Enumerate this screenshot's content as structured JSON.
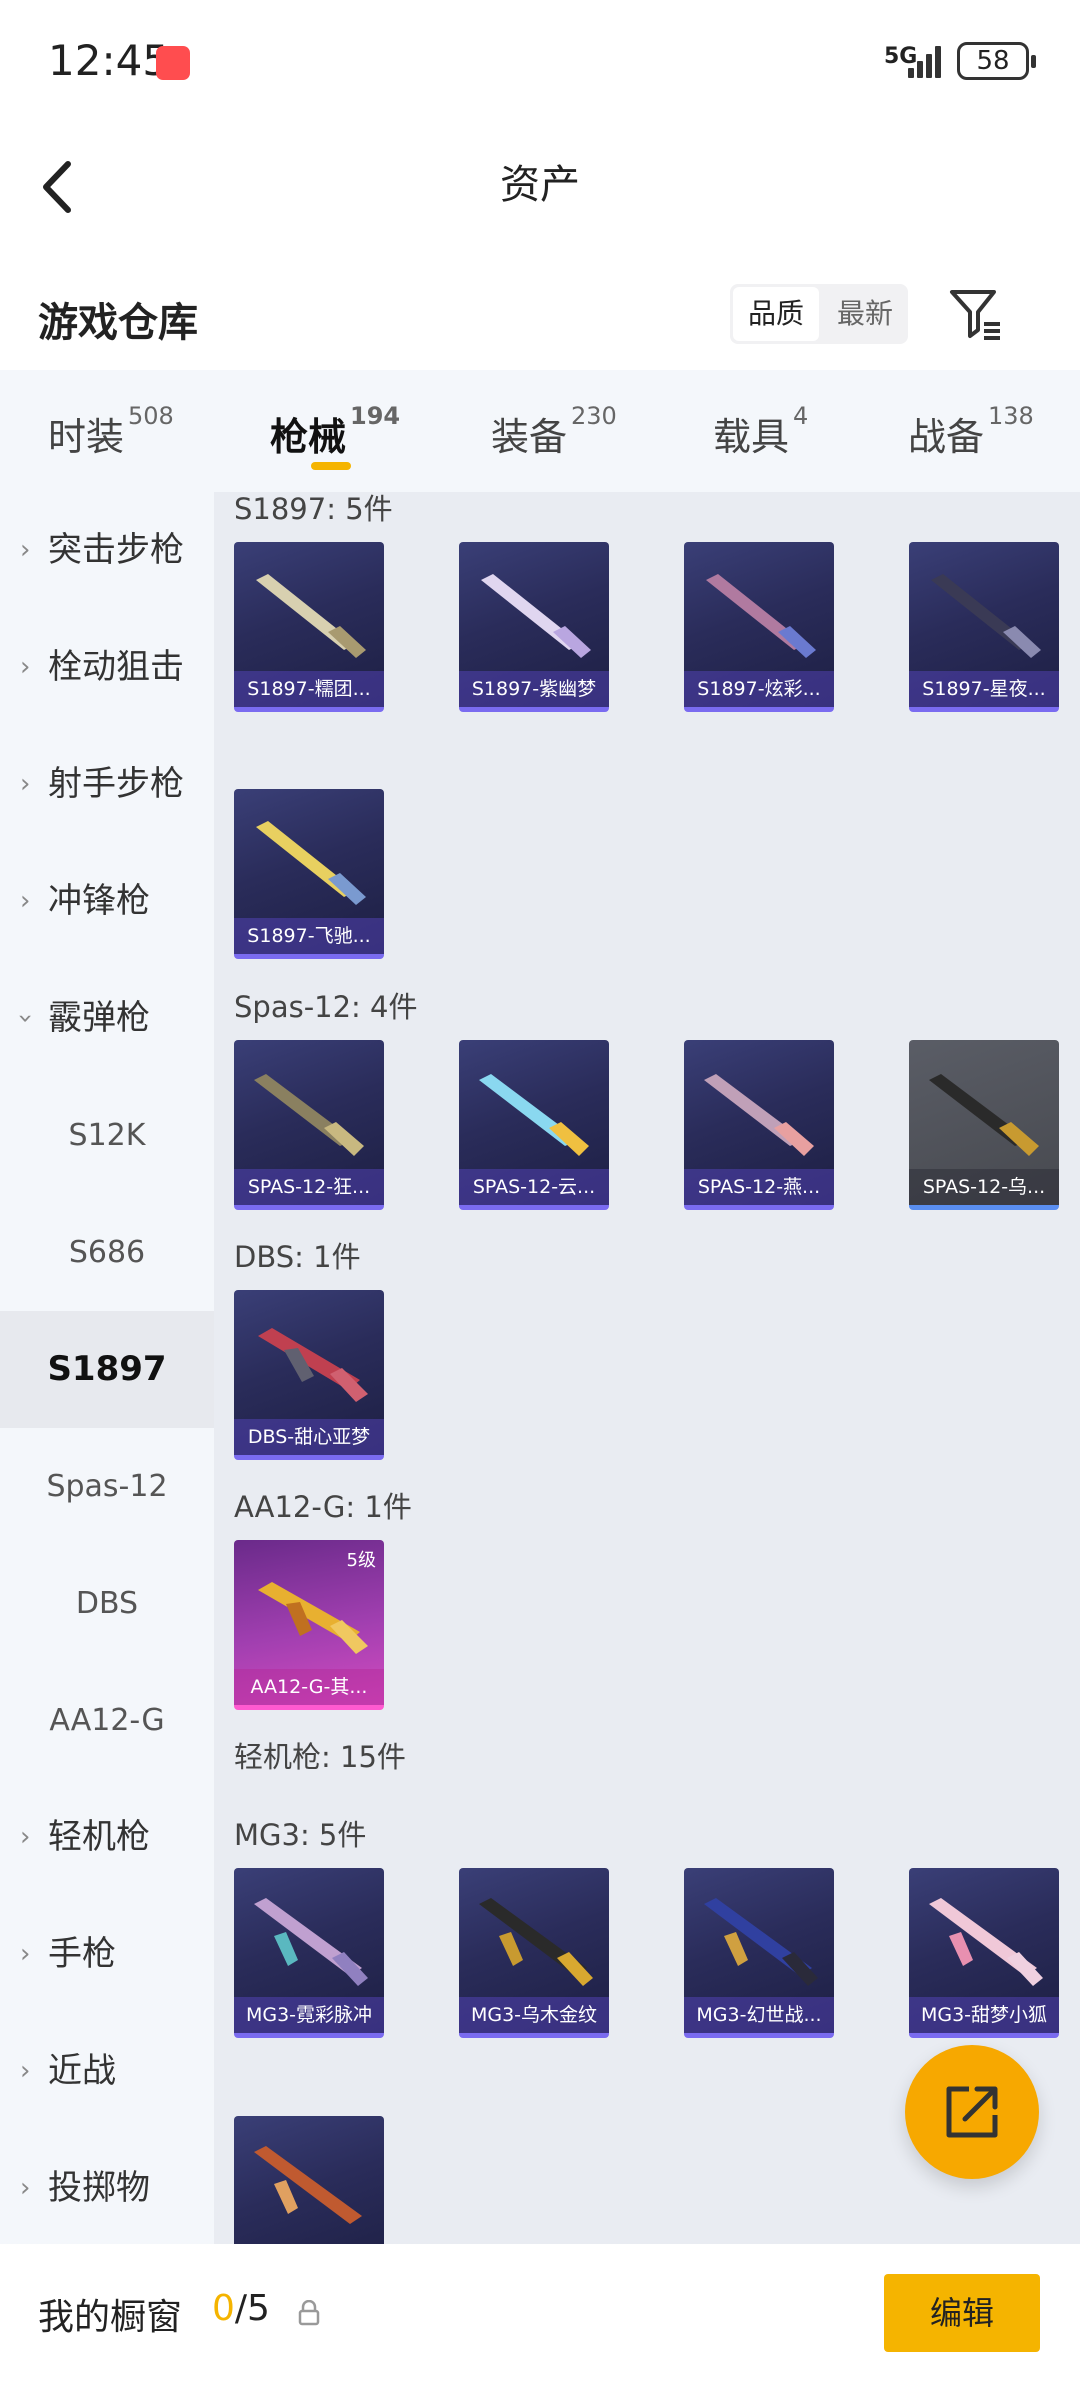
{
  "status_bar": {
    "time": "12:45",
    "network": "5G",
    "battery": "58"
  },
  "header": {
    "title": "资产"
  },
  "warehouse": {
    "title": "游戏仓库",
    "sort_options": [
      "品质",
      "最新"
    ],
    "selected_sort": "品质"
  },
  "tabs": [
    {
      "label": "时装",
      "count": "508"
    },
    {
      "label": "枪械",
      "count": "194"
    },
    {
      "label": "装备",
      "count": "230"
    },
    {
      "label": "载具",
      "count": "4"
    },
    {
      "label": "战备",
      "count": "138"
    }
  ],
  "active_tab": "枪械",
  "sidebar": [
    {
      "label": "突击步枪",
      "type": "category",
      "expanded": false
    },
    {
      "label": "栓动狙击",
      "type": "category",
      "expanded": false
    },
    {
      "label": "射手步枪",
      "type": "category",
      "expanded": false
    },
    {
      "label": "冲锋枪",
      "type": "category",
      "expanded": false
    },
    {
      "label": "霰弹枪",
      "type": "category",
      "expanded": true
    },
    {
      "label": "S12K",
      "type": "sub"
    },
    {
      "label": "S686",
      "type": "sub"
    },
    {
      "label": "S1897",
      "type": "sub",
      "selected": true
    },
    {
      "label": "Spas-12",
      "type": "sub"
    },
    {
      "label": "DBS",
      "type": "sub"
    },
    {
      "label": "AA12-G",
      "type": "sub"
    },
    {
      "label": "轻机枪",
      "type": "category",
      "expanded": false
    },
    {
      "label": "手枪",
      "type": "category",
      "expanded": false
    },
    {
      "label": "近战",
      "type": "category",
      "expanded": false
    },
    {
      "label": "投掷物",
      "type": "category",
      "expanded": false
    }
  ],
  "sections": [
    {
      "title": "S1897: 5件",
      "items": [
        "S1897-糯团...",
        "S1897-紫幽梦",
        "S1897-炫彩...",
        "S1897-星夜...",
        "S1897-飞驰..."
      ]
    },
    {
      "title": "Spas-12: 4件",
      "items": [
        "SPAS-12-狂...",
        "SPAS-12-云...",
        "SPAS-12-燕...",
        "SPAS-12-乌..."
      ]
    },
    {
      "title": "DBS: 1件",
      "items": [
        "DBS-甜心亚梦"
      ]
    },
    {
      "title": "AA12-G: 1件",
      "items": [
        "AA12-G-其..."
      ],
      "level": "5级"
    },
    {
      "title": "轻机枪: 15件",
      "items": []
    },
    {
      "title": "MG3: 5件",
      "items": [
        "MG3-霓彩脉冲",
        "MG3-乌木金纹",
        "MG3-幻世战...",
        "MG3-甜梦小狐",
        ""
      ]
    }
  ],
  "bottom_bar": {
    "label": "我的橱窗",
    "count_current": "0",
    "count_total": "/5",
    "edit_label": "编辑"
  },
  "colors": {
    "accent": "#f5b400",
    "card_purple": "#2a2c5a",
    "card_pink": "#a13fb0",
    "card_gray": "#52555c"
  },
  "icons": [
    "back-arrow-icon",
    "filter-icon",
    "chevron-right-icon",
    "chevron-down-icon",
    "lock-icon",
    "share-icon"
  ]
}
